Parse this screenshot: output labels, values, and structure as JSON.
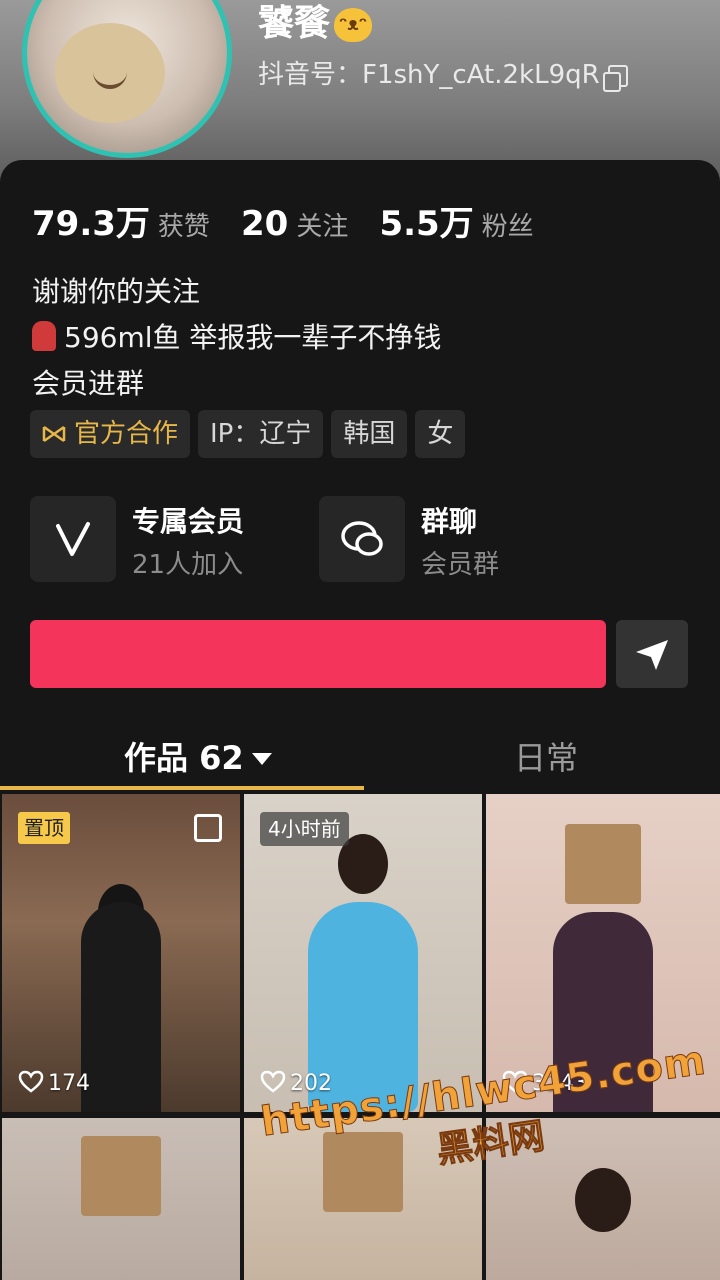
{
  "profile": {
    "nickname": "饕餮",
    "douyin_id_label": "抖音号：",
    "douyin_id": "F1shY_cAt.2kL9qR"
  },
  "stats": [
    {
      "num": "79.3万",
      "label": "获赞"
    },
    {
      "num": "20",
      "label": "关注"
    },
    {
      "num": "5.5万",
      "label": "粉丝"
    }
  ],
  "bio": {
    "line1": "谢谢你的关注",
    "line2": "596ml鱼 举报我一辈子不挣钱",
    "line3": "会员进群"
  },
  "tags": {
    "official": "官方合作",
    "ip": "IP：辽宁",
    "country": "韩国",
    "gender": "女"
  },
  "features": [
    {
      "title": "专属会员",
      "sub": "21人加入",
      "icon": "membership-v-icon"
    },
    {
      "title": "群聊",
      "sub": "会员群",
      "icon": "chat-bubbles-icon"
    }
  ],
  "actions": {
    "follow_label": "",
    "share_icon": "send-arrow-icon"
  },
  "tabs": {
    "works_label": "作品 62",
    "daily_label": "日常"
  },
  "videos": [
    {
      "badge": "置顶",
      "likes": "174"
    },
    {
      "badge": "4小时前",
      "likes": "202"
    },
    {
      "badge": "",
      "likes": "3243"
    }
  ],
  "watermark": {
    "url": "https://hlwc45.com",
    "text": "黑料网"
  },
  "colors": {
    "accent_red": "#f4345a",
    "gold": "#e7b74a",
    "avatar_ring": "#2fc2b2",
    "background": "#161616"
  }
}
